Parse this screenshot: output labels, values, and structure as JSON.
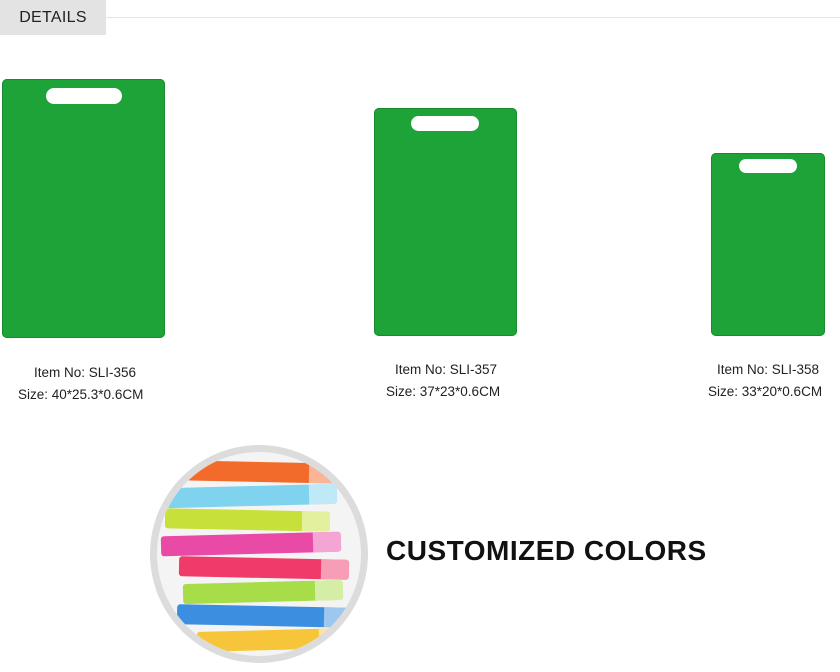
{
  "header": {
    "tab_label": "DETAILS"
  },
  "products": [
    {
      "item_no": "Item No: SLI-356",
      "size": "Size:  40*25.3*0.6CM"
    },
    {
      "item_no": "Item No: SLI-357",
      "size": "Size:  37*23*0.6CM"
    },
    {
      "item_no": "Item No: SLI-358",
      "size": "Size:  33*20*0.6CM"
    }
  ],
  "colors": {
    "board_green": "#1ea338",
    "stack": [
      "#f26b2a",
      "#7fd3ee",
      "#c7e03a",
      "#e94aa6",
      "#ef3a6a",
      "#a8dd4a",
      "#3c8fe0",
      "#f7c53a"
    ]
  },
  "feature": {
    "headline": "CUSTOMIZED COLORS"
  }
}
